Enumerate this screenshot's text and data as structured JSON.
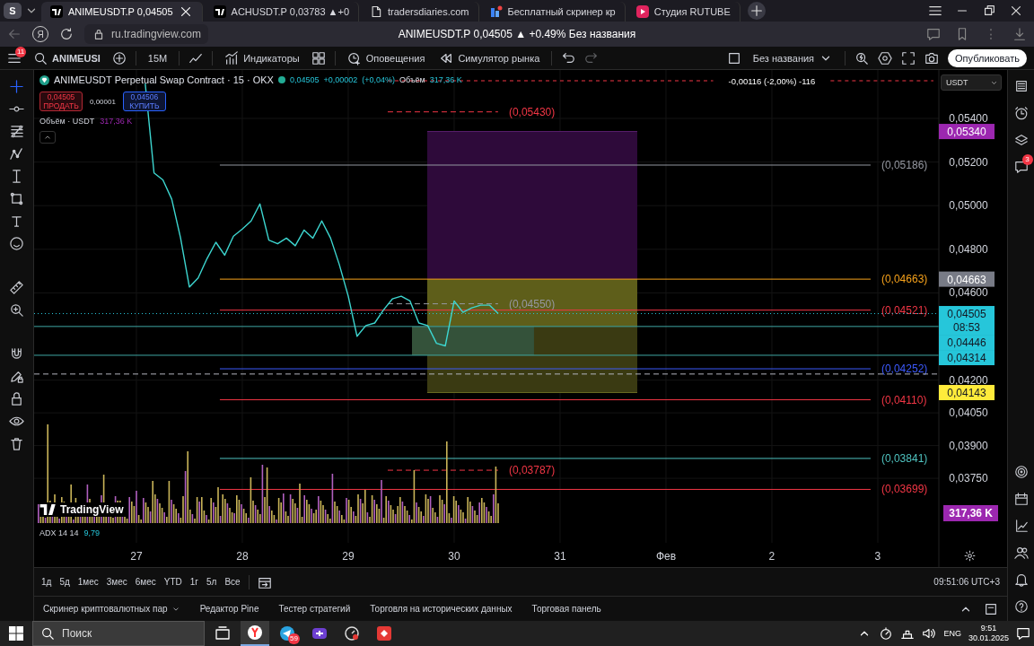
{
  "browser": {
    "profile": "S",
    "home_glyph": "Я",
    "address": "ru.tradingview.com",
    "page_title": "ANIMEUSDT.P 0,04505 ▲ +0.49% Без названия",
    "tabs": [
      {
        "title": "ANIMEUSDT.P 0,04505",
        "kind": "tradingview",
        "selected": true
      },
      {
        "title": "ACHUSDT.P 0,03783 ▲+0",
        "kind": "tradingview",
        "selected": false
      },
      {
        "title": "tradersdiaries.com",
        "kind": "page",
        "selected": false
      },
      {
        "title": "Бесплатный скринер кр",
        "kind": "screener",
        "selected": false
      },
      {
        "title": "Студия RUTUBE",
        "kind": "rutube",
        "selected": false
      }
    ]
  },
  "toolbar": {
    "menu_badge": "11",
    "symbol": "ANIMEUSI",
    "interval": "15M",
    "indicators": "Индикаторы",
    "alerts": "Оповещения",
    "replay": "Симулятор рынка",
    "undo_disabled": false,
    "redo_disabled": true,
    "layout_name": "Без названия",
    "publish": "Опубликовать"
  },
  "left_tools": [
    {
      "kind": "crosshair",
      "selected": true
    },
    {
      "kind": "trendline",
      "selected": false
    },
    {
      "kind": "fib",
      "selected": false
    },
    {
      "kind": "pattern",
      "selected": false
    },
    {
      "kind": "beam",
      "selected": false
    },
    {
      "kind": "shape",
      "selected": false
    },
    {
      "kind": "text",
      "selected": false
    },
    {
      "kind": "smiley",
      "selected": false
    },
    {
      "kind": "ruler",
      "selected": false
    },
    {
      "kind": "zoom",
      "selected": false
    },
    {
      "kind": "magnet",
      "selected": false
    },
    {
      "kind": "pencil-lock",
      "selected": false
    },
    {
      "kind": "lock",
      "selected": false
    },
    {
      "kind": "eye",
      "selected": false
    },
    {
      "kind": "trash",
      "selected": false
    }
  ],
  "legend": {
    "title": "ANIMEUSDT Perpetual Swap Contract · 15 · OKX",
    "price": "0,04505",
    "change": "+0,00002",
    "change_pct": "(+0,04%)",
    "volume_label": "Объём",
    "volume": "317,36 K",
    "sell_price": "0,04505",
    "sell_label": "ПРОДАТЬ",
    "spread": "0,00001",
    "buy_price": "0,04506",
    "buy_label": "КУПИТЬ",
    "volume_study": "Объём · USDT",
    "volume_study_value": "317,36 K"
  },
  "currency": "USDT",
  "logo": "TradingView",
  "adx": {
    "label": "ADX 14 14",
    "value": "9,79"
  },
  "volume_badge": "317,36 K",
  "chart_data": {
    "type": "line",
    "grid": true,
    "ylim": [
      0.03343,
      0.05622
    ],
    "categories": [
      null,
      null,
      null,
      null,
      null,
      null,
      null,
      null,
      null,
      null,
      null,
      "27",
      null,
      null,
      null,
      null,
      null,
      null,
      null,
      null,
      null,
      null,
      null,
      "28",
      null,
      null,
      null,
      null,
      null,
      null,
      null,
      null,
      null,
      null,
      null,
      "29",
      null,
      null,
      null,
      null,
      null,
      null,
      null,
      null,
      null,
      null,
      null,
      "30",
      null,
      null,
      null,
      null,
      null,
      null,
      null,
      null,
      null,
      null,
      null,
      "31",
      null,
      null,
      null,
      null,
      null,
      null,
      null,
      null,
      null,
      null,
      null,
      "Фев",
      null,
      null,
      null,
      null,
      null,
      null,
      null,
      null,
      null,
      null,
      null,
      "2",
      null,
      null,
      null,
      null,
      null,
      null,
      null,
      null,
      null,
      null,
      null,
      "3",
      null,
      null,
      null,
      null,
      null,
      null
    ],
    "yticks": [
      {
        "value": 0.054,
        "label": "0,05400"
      },
      {
        "value": 0.052,
        "label": "0,05200"
      },
      {
        "value": 0.05,
        "label": "0,05000"
      },
      {
        "value": 0.048,
        "label": "0,04800"
      },
      {
        "value": 0.046,
        "label": "0,04600"
      },
      {
        "value": 0.042,
        "label": "0,04200"
      },
      {
        "value": 0.0405,
        "label": "0,04050"
      },
      {
        "value": 0.039,
        "label": "0,03900"
      },
      {
        "value": 0.0375,
        "label": "0,03750"
      }
    ],
    "series": [
      {
        "color": "#3dd6d0",
        "values": [
          null,
          null,
          null,
          null,
          null,
          null,
          null,
          null,
          null,
          null,
          null,
          null,
          0.0556,
          0.0515,
          0.05118,
          0.0503,
          0.04853,
          0.04627,
          0.04669,
          0.04757,
          0.04832,
          0.04773,
          0.0486,
          0.04893,
          0.0493,
          0.05008,
          0.04842,
          0.04825,
          0.04851,
          0.04816,
          0.04888,
          0.04851,
          0.0493,
          0.04851,
          0.04729,
          0.04585,
          0.04401,
          0.0445,
          0.04462,
          0.04522,
          0.04572,
          0.04585,
          0.04563,
          0.04462,
          0.0445,
          0.04369,
          0.04357,
          0.04563,
          0.04511,
          0.04531,
          0.04544,
          0.04544,
          0.04505,
          null,
          null,
          null,
          null,
          null,
          null,
          null,
          null,
          null,
          null,
          null,
          null,
          null,
          null,
          null,
          null,
          null,
          null,
          null,
          null,
          null,
          null,
          null,
          null,
          null,
          null,
          null,
          null,
          null,
          null,
          null,
          null,
          null,
          null,
          null,
          null,
          null,
          null,
          null,
          null,
          null,
          null,
          null,
          null,
          null,
          null,
          null,
          null,
          null
        ]
      }
    ],
    "bands": [
      {
        "axis": "y",
        "from": 0.04663,
        "to": 0.0534,
        "color": "#2e0a3a"
      },
      {
        "axis": "y",
        "from": 0.04446,
        "to": 0.04663,
        "color": "#5e5e1a"
      },
      {
        "axis": "y",
        "from": 0.04143,
        "to": 0.04446,
        "color": "#3a3a12"
      },
      {
        "axis": "y",
        "from": 0.04314,
        "to": 0.04446,
        "color": "#34523a"
      }
    ],
    "ref_lines": [
      {
        "axis": "y",
        "value": 0.0543,
        "color": "#f23645",
        "label": "(0,05430)"
      },
      {
        "axis": "y",
        "value": 0.0534,
        "color": "#5a1f6e"
      },
      {
        "axis": "y",
        "value": 0.05186,
        "color": "#9598a1",
        "label": "(0,05186)"
      },
      {
        "axis": "y",
        "value": 0.04663,
        "color": "#f7a21b",
        "label": "(0,04663)"
      },
      {
        "axis": "y",
        "value": 0.0455,
        "color": "#9598a1",
        "label": "(0,04550)"
      },
      {
        "axis": "y",
        "value": 0.04521,
        "color": "#f23645",
        "label": "(0,04521)"
      },
      {
        "axis": "y",
        "value": 0.04505,
        "color": "#26c6da"
      },
      {
        "axis": "y",
        "value": 0.04446,
        "color": "#3fa8a4"
      },
      {
        "axis": "y",
        "value": 0.04314,
        "color": "#3fa8a4"
      },
      {
        "axis": "y",
        "value": 0.04252,
        "color": "#3d5afe",
        "label": "(0,04252)"
      },
      {
        "axis": "y",
        "value": 0.04228,
        "color": "#b2b5be"
      },
      {
        "axis": "y",
        "value": 0.04143,
        "color": "#6a6a22"
      },
      {
        "axis": "y",
        "value": 0.0411,
        "color": "#f23645",
        "label": "(0,04110)"
      },
      {
        "axis": "y",
        "value": 0.03841,
        "color": "#4fc3c0",
        "label": "(0,03841)"
      },
      {
        "axis": "y",
        "value": 0.03787,
        "color": "#f23645",
        "label": "(0,03787)"
      },
      {
        "axis": "y",
        "value": 0.03699,
        "color": "#f23645",
        "label": "(0,03699)"
      }
    ],
    "annotations": [
      "-0,00116 (-2,00%) -116"
    ]
  },
  "drawings": [
    {
      "kind": "short"
    },
    {
      "kind": "edge",
      "badge": "0,05340",
      "color": "#9c27b0"
    },
    {
      "kind": "segment"
    },
    {
      "kind": "segment",
      "badge": "0,04663",
      "color": "#787b86"
    },
    {
      "kind": "short"
    },
    {
      "kind": "segment"
    },
    {
      "kind": "price",
      "badge": "0,04505",
      "badge_sub": "08:53",
      "color": "#26c6da"
    },
    {
      "kind": "full",
      "badge": "0,04446",
      "color": "#26c6da"
    },
    {
      "kind": "full",
      "badge": "0,04314",
      "color": "#26c6da"
    },
    {
      "kind": "segment"
    },
    {
      "kind": "marker"
    },
    {
      "kind": "edge",
      "badge": "0,04143",
      "color": "#ffeb3b"
    },
    {
      "kind": "segment"
    },
    {
      "kind": "segment"
    },
    {
      "kind": "short"
    },
    {
      "kind": "segment"
    }
  ],
  "zones": [
    {
      "kind": "box"
    },
    {
      "kind": "box"
    },
    {
      "kind": "box"
    },
    {
      "kind": "inner"
    }
  ],
  "range_buttons": [
    "1д",
    "5д",
    "1мес",
    "3мес",
    "6мес",
    "YTD",
    "1г",
    "5л",
    "Все"
  ],
  "clock": "09:51:06 UTC+3",
  "panel_tabs": [
    {
      "label": "Скринер криптовалютных пар",
      "dropdown": true
    },
    {
      "label": "Редактор Pine",
      "dropdown": false
    },
    {
      "label": "Тестер стратегий",
      "dropdown": false
    },
    {
      "label": "Торговля на исторических данных",
      "dropdown": false
    },
    {
      "label": "Торговая панель",
      "dropdown": false
    }
  ],
  "right_sidebar": {
    "chat_badge": "3"
  },
  "taskbar": {
    "search_placeholder": "Поиск",
    "language": "ENG",
    "time": "9:51",
    "date": "30.01.2025",
    "apps": [
      {
        "kind": "browser",
        "selected": true
      },
      {
        "kind": "messenger",
        "selected": false,
        "badge": "59"
      },
      {
        "kind": "purple",
        "selected": false
      },
      {
        "kind": "gauge",
        "selected": false
      },
      {
        "kind": "red",
        "selected": false
      }
    ]
  }
}
